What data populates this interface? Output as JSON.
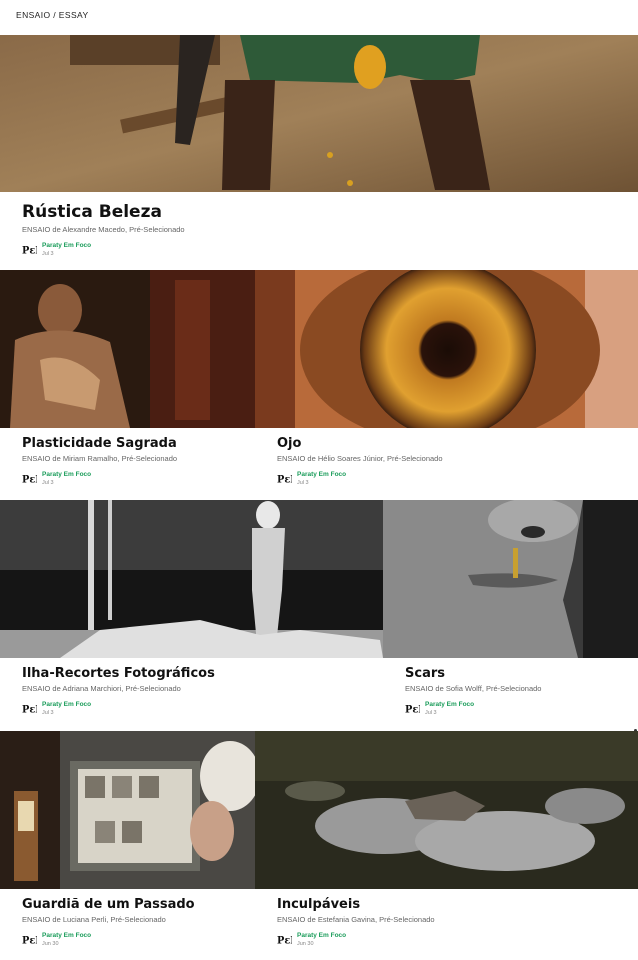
{
  "header": {
    "breadcrumb": "ENSAIO / ESSAY"
  },
  "publication": {
    "name": "Paraty Em Foco",
    "logo_icon": "pef-logo-icon",
    "name_color": "#1a9c5a"
  },
  "cards": [
    {
      "title": "Rústica Beleza",
      "subtitle": "ENSAIO de Alexandre Macedo, Pré-Selecionado",
      "date": "Jul 3",
      "image": "seated-person-sandy-ground-photo"
    },
    {
      "title": "Plasticidade Sagrada",
      "subtitle": "ENSAIO de Miriam Ramalho, Pré-Selecionado",
      "date": "Jul 3",
      "image": "religious-statue-photo"
    },
    {
      "title": "Ojo",
      "subtitle": "ENSAIO de Hélio Soares Júnior, Pré-Selecionado",
      "date": "Jul 3",
      "image": "eye-iris-macro-photo"
    },
    {
      "title": "Ilha-Recortes Fotográficos",
      "subtitle": "ENSAIO de Adriana Marchiori, Pré-Selecionado",
      "date": "Jul 3",
      "image": "bw-figurine-river-photo"
    },
    {
      "title": "Scars",
      "subtitle": "ENSAIO de Sofia Wolff, Pré-Selecionado",
      "date": "Jul 3",
      "image": "bw-face-closeup-photo"
    },
    {
      "title": "Guardiã de um Passado",
      "subtitle": "ENSAIO de Luciana Perli, Pré-Selecionado",
      "date": "Jun 30",
      "image": "woman-viewing-frame-photo"
    },
    {
      "title": "Inculpáveis",
      "subtitle": "ENSAIO de Estefania Gavina, Pré-Selecionado",
      "date": "Jun 30",
      "image": "dead-bird-feathers-photo"
    }
  ]
}
